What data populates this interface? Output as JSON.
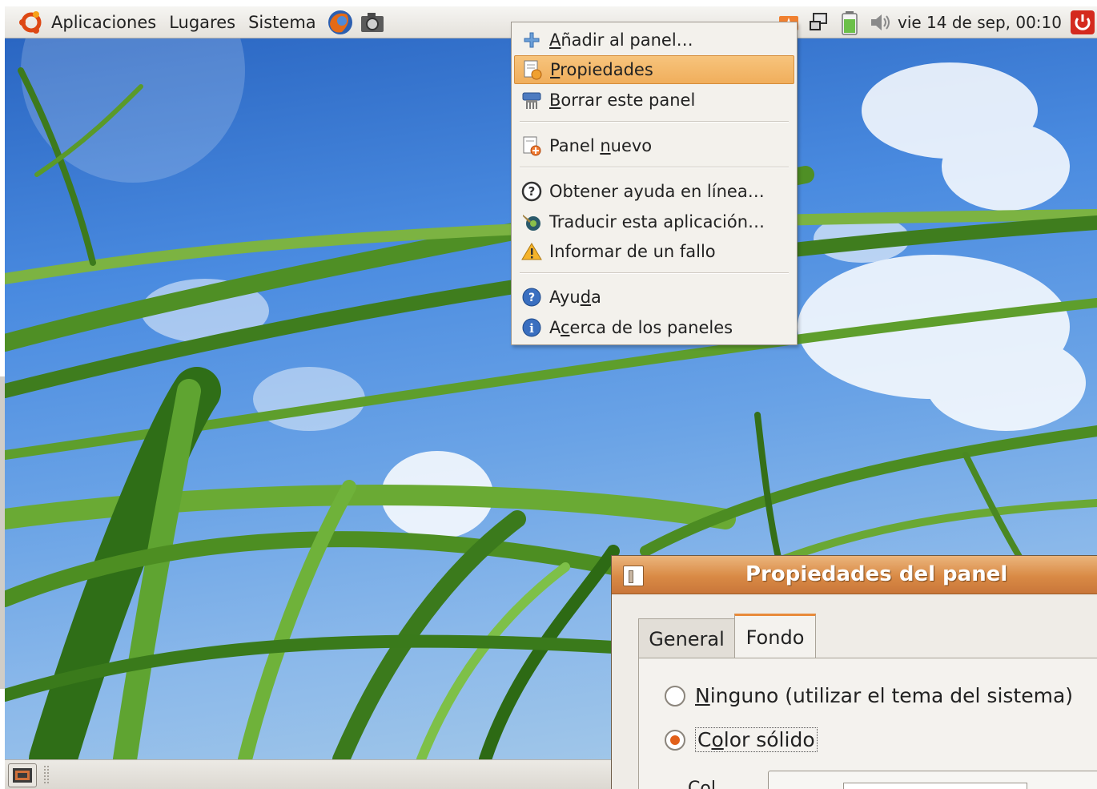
{
  "top_panel": {
    "menus": [
      "Aplicaciones",
      "Lugares",
      "Sistema"
    ],
    "launchers": [
      "firefox-icon",
      "camera-icon"
    ],
    "clock": "vie 14 de sep, 00:10"
  },
  "context_menu": {
    "items": [
      {
        "pre": "",
        "u": "A",
        "post": "ñadir al panel…",
        "icon": "plus-icon"
      },
      {
        "pre": "",
        "u": "P",
        "post": "ropiedades",
        "icon": "properties-icon",
        "highlighted": true
      },
      {
        "pre": "",
        "u": "B",
        "post": "orrar este panel",
        "icon": "shredder-icon"
      },
      {
        "pre": "Panel ",
        "u": "n",
        "post": "uevo",
        "icon": "new-panel-icon"
      },
      {
        "pre": "Obtener ayuda en línea…",
        "u": "",
        "post": "",
        "icon": "help-online-icon"
      },
      {
        "pre": "Traducir esta aplicación…",
        "u": "",
        "post": "",
        "icon": "translate-icon"
      },
      {
        "pre": "Informar de un fallo",
        "u": "",
        "post": "",
        "icon": "warning-icon"
      },
      {
        "pre": "Ayu",
        "u": "d",
        "post": "a",
        "icon": "help-icon"
      },
      {
        "pre": "A",
        "u": "c",
        "post": "erca de los paneles",
        "icon": "info-icon"
      }
    ]
  },
  "dialog": {
    "title": "Propiedades del panel",
    "tabs": [
      "General",
      "Fondo"
    ],
    "active_tab": "Fondo",
    "options": [
      {
        "pre": "",
        "u": "N",
        "post": "inguno (utilizar el tema del sistema)",
        "selected": false
      },
      {
        "pre": "C",
        "u": "o",
        "post": "lor sólido",
        "selected": true
      }
    ],
    "color_label_partial": "Col"
  },
  "colors": {
    "accent": "#e88a3a",
    "highlight": "#f3b56a",
    "panel_bg": "#ebe8e3",
    "sky": "#4a8be0",
    "grass": "#3f8a1f"
  }
}
